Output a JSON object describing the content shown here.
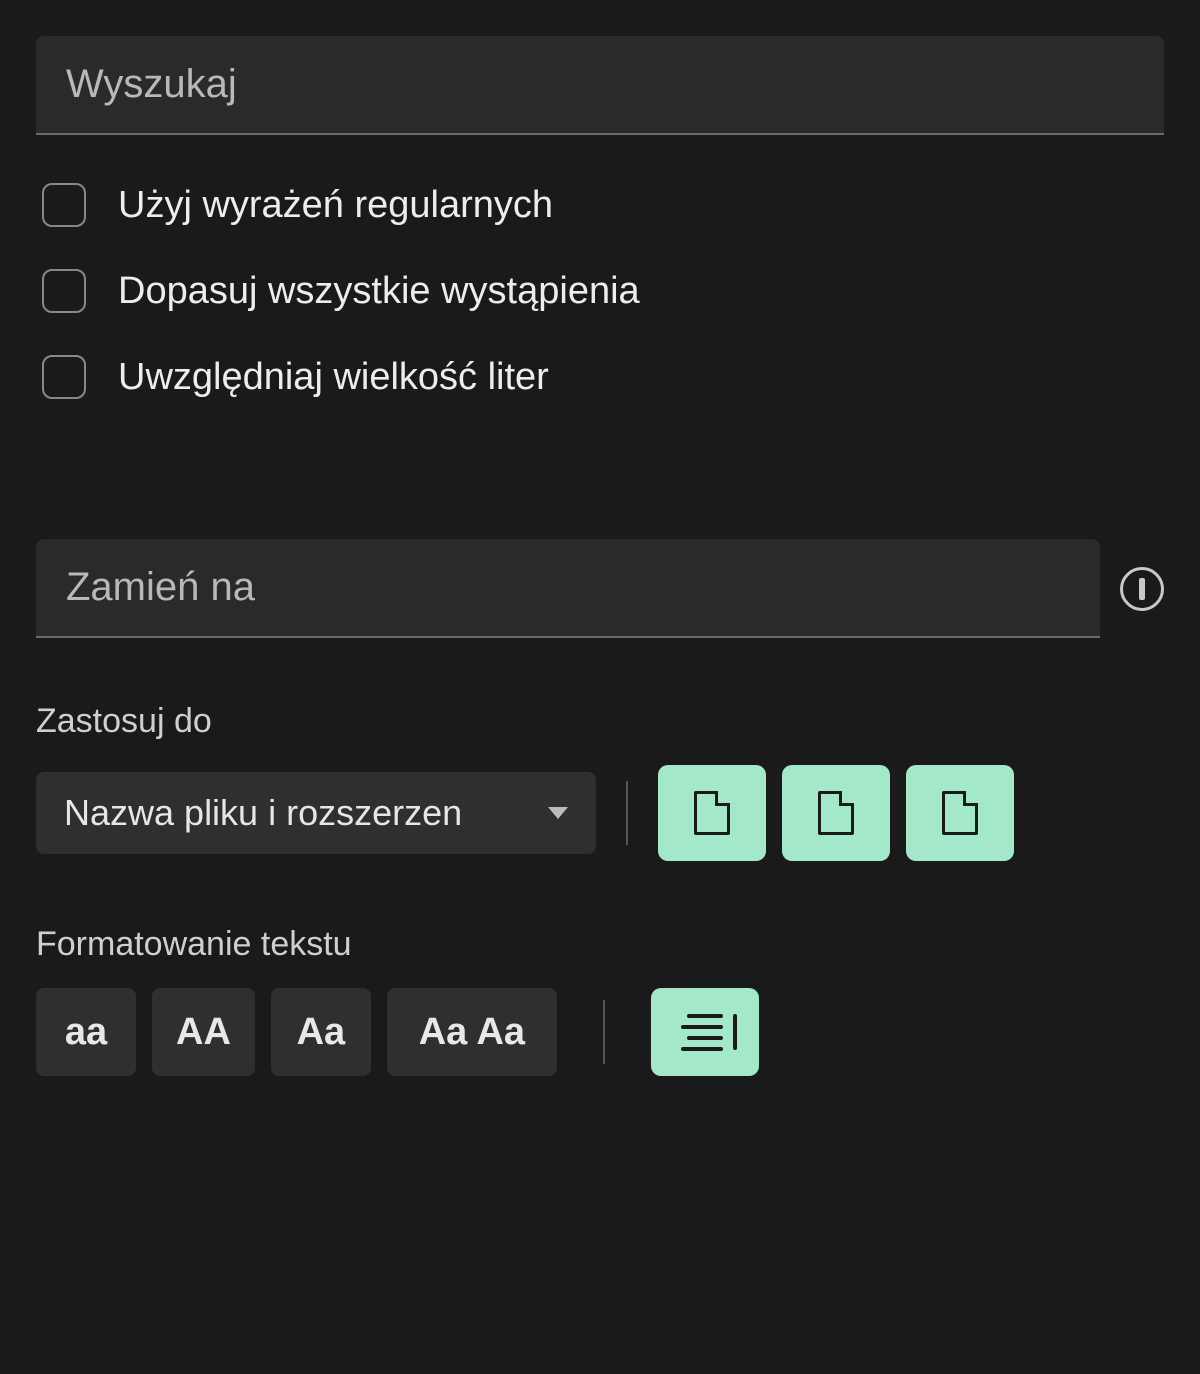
{
  "search": {
    "placeholder": "Wyszukaj",
    "value": ""
  },
  "options": {
    "regex_label": "Użyj wyrażeń regularnych",
    "match_all_label": "Dopasuj wszystkie wystąpienia",
    "case_sensitive_label": "Uwzględniaj wielkość liter"
  },
  "replace": {
    "placeholder": "Zamień na",
    "value": ""
  },
  "apply_to": {
    "label": "Zastosuj do",
    "selected": "Nazwa pliku i rozszerzen"
  },
  "formatting": {
    "label": "Formatowanie tekstu",
    "buttons": {
      "lowercase": "aa",
      "uppercase": "AA",
      "capitalize": "Aa",
      "titlecase": "Aa Aa"
    }
  },
  "colors": {
    "accent": "#a2e8c9",
    "bg": "#1a1a1a",
    "panel": "#2f2f2f"
  }
}
